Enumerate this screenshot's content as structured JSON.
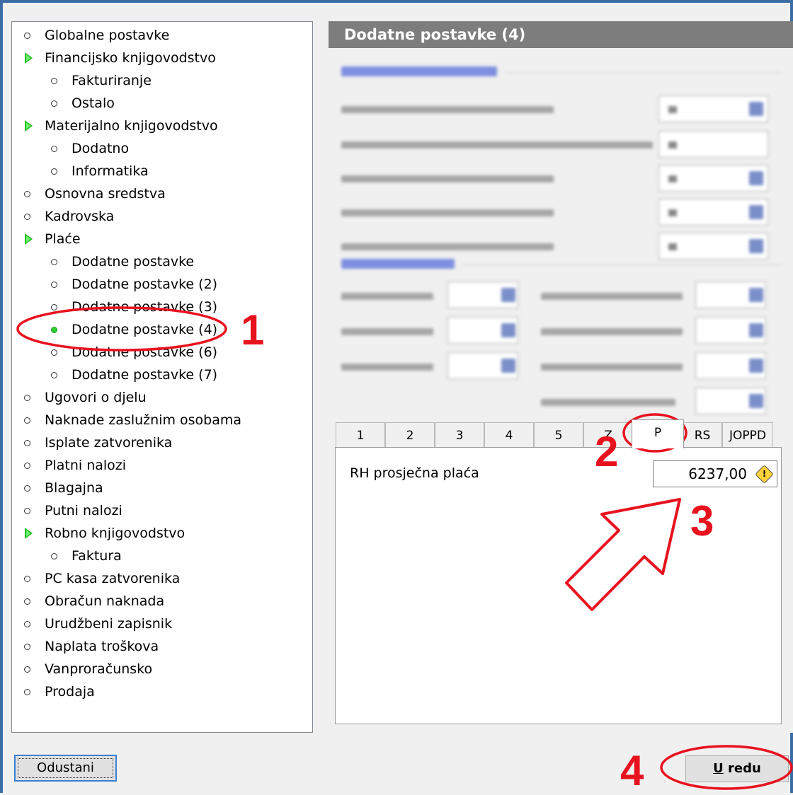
{
  "tree": {
    "items": [
      {
        "label": "Globalne postavke",
        "kind": "bullet"
      },
      {
        "label": "Financijsko knjigovodstvo",
        "kind": "arrow"
      },
      {
        "label": "Fakturiranje",
        "kind": "bullet"
      },
      {
        "label": "Ostalo",
        "kind": "bullet"
      },
      {
        "label": "Materijalno knjigovodstvo",
        "kind": "arrow"
      },
      {
        "label": "Dodatno",
        "kind": "bullet"
      },
      {
        "label": "Informatika",
        "kind": "bullet"
      },
      {
        "label": "Osnovna sredstva",
        "kind": "bullet"
      },
      {
        "label": "Kadrovska",
        "kind": "bullet"
      },
      {
        "label": "Plaće",
        "kind": "arrow"
      },
      {
        "label": "Dodatne postavke",
        "kind": "bullet"
      },
      {
        "label": "Dodatne postavke (2)",
        "kind": "bullet"
      },
      {
        "label": "Dodatne postavke (3)",
        "kind": "bullet"
      },
      {
        "label": "Dodatne postavke (4)",
        "kind": "bullet",
        "selected": true
      },
      {
        "label": "Dodatne postavke (6)",
        "kind": "bullet"
      },
      {
        "label": "Dodatne postavke (7)",
        "kind": "bullet"
      },
      {
        "label": "Ugovori o djelu",
        "kind": "bullet"
      },
      {
        "label": "Naknade zaslužnim osobama",
        "kind": "bullet"
      },
      {
        "label": "Isplate zatvorenika",
        "kind": "bullet"
      },
      {
        "label": "Platni nalozi",
        "kind": "bullet"
      },
      {
        "label": "Blagajna",
        "kind": "bullet"
      },
      {
        "label": "Putni nalozi",
        "kind": "bullet"
      },
      {
        "label": "Robno knjigovodstvo",
        "kind": "arrow"
      },
      {
        "label": "Faktura",
        "kind": "bullet"
      },
      {
        "label": "PC kasa zatvorenika",
        "kind": "bullet"
      },
      {
        "label": "Obračun naknada",
        "kind": "bullet"
      },
      {
        "label": "Urudžbeni zapisnik",
        "kind": "bullet"
      },
      {
        "label": "Naplata troškova",
        "kind": "bullet"
      },
      {
        "label": "Vanproračunsko",
        "kind": "bullet"
      },
      {
        "label": "Prodaja",
        "kind": "bullet"
      }
    ]
  },
  "panel": {
    "title": "Dodatne postavke (4)"
  },
  "tabs": {
    "items": [
      "1",
      "2",
      "3",
      "4",
      "5",
      "Z",
      "P",
      "RS",
      "JOPPD"
    ],
    "selected": "P"
  },
  "field": {
    "label": "RH prosječna plaća",
    "value": "6237,00"
  },
  "buttons": {
    "cancel": "Odustani",
    "ok_underlined": "U",
    "ok_rest": " redu"
  },
  "annotations": {
    "n1": "1",
    "n2": "2",
    "n3": "3",
    "n4": "4",
    "color": "#e8121f"
  },
  "icons": {
    "tree_expand": "green-triangle-icon",
    "tree_leaf": "circle-bullet-icon",
    "warning": "warning-icon",
    "callout": "outlined-arrow-icon"
  }
}
